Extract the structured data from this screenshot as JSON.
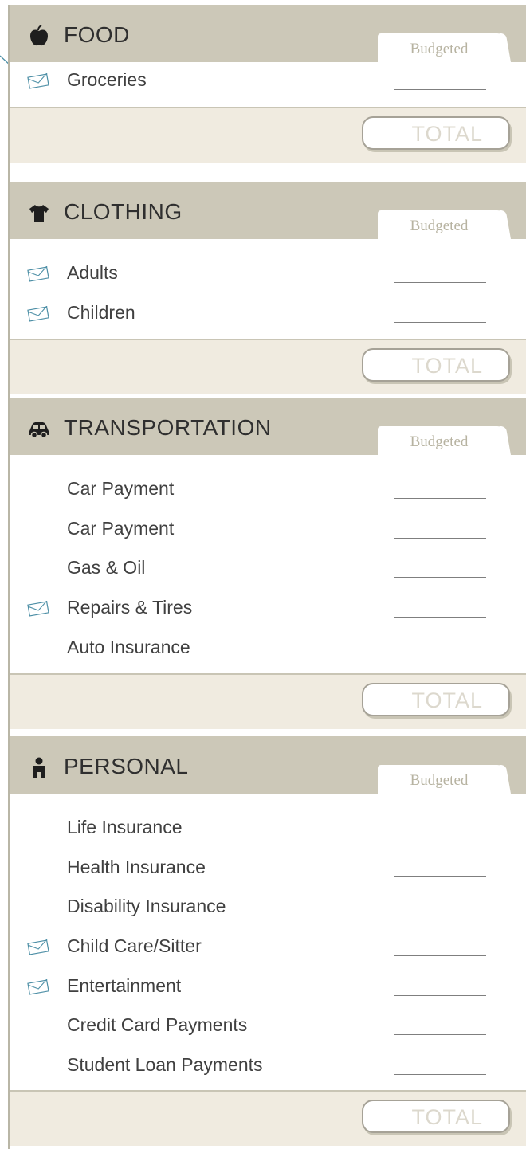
{
  "budgeted_label": "Budgeted",
  "total_label": "TOTAL",
  "colors": {
    "header_bg": "#ccc8b8",
    "total_band": "#f0ebe0",
    "envelope": "#4d8fa6",
    "text": "#404040"
  },
  "sections": [
    {
      "title": "FOOD",
      "icon": "apple-icon",
      "items": [
        {
          "label": "Groceries",
          "envelope": true
        }
      ]
    },
    {
      "title": "CLOTHING",
      "icon": "shirt-icon",
      "items": [
        {
          "label": "Adults",
          "envelope": true
        },
        {
          "label": "Children",
          "envelope": true
        }
      ]
    },
    {
      "title": "TRANSPORTATION",
      "icon": "car-icon",
      "items": [
        {
          "label": "Car Payment",
          "envelope": false
        },
        {
          "label": "Car Payment",
          "envelope": false
        },
        {
          "label": "Gas & Oil",
          "envelope": false
        },
        {
          "label": "Repairs & Tires",
          "envelope": true
        },
        {
          "label": "Auto Insurance",
          "envelope": false
        }
      ]
    },
    {
      "title": "PERSONAL",
      "icon": "person-icon",
      "items": [
        {
          "label": "Life Insurance",
          "envelope": false
        },
        {
          "label": "Health Insurance",
          "envelope": false
        },
        {
          "label": "Disability Insurance",
          "envelope": false
        },
        {
          "label": "Child Care/Sitter",
          "envelope": true
        },
        {
          "label": "Entertainment",
          "envelope": true
        },
        {
          "label": "Credit Card Payments",
          "envelope": false
        },
        {
          "label": "Student Loan Payments",
          "envelope": false
        }
      ]
    }
  ]
}
